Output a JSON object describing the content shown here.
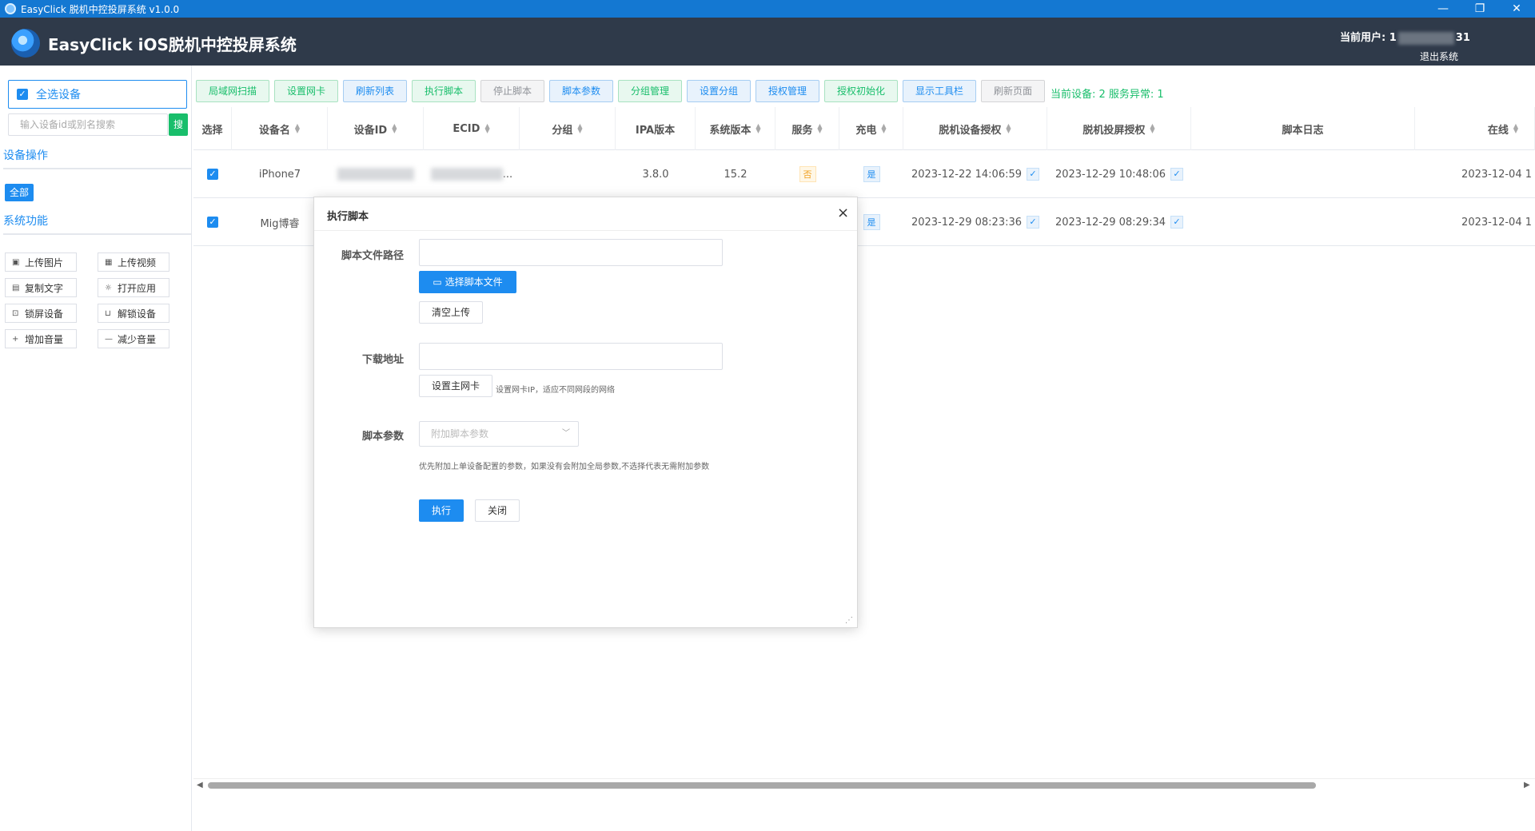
{
  "window": {
    "title": "EasyClick 脱机中控投屏系统 v1.0.0",
    "minimize": "—",
    "restore": "❐",
    "close": "✕"
  },
  "header": {
    "app_title": "EasyClick iOS脱机中控投屏系统",
    "user_label": "当前用户: 1",
    "user_suffix": "31",
    "logout": "退出系统"
  },
  "sidebar": {
    "select_all": "全选设备",
    "search_placeholder": "输入设备id或别名搜索",
    "search_button": "搜",
    "device_ops_title": "设备操作",
    "all_button": "全部",
    "system_title": "系统功能",
    "functions": [
      {
        "label": "上传图片",
        "icon": "image-icon"
      },
      {
        "label": "上传视频",
        "icon": "video-icon"
      },
      {
        "label": "复制文字",
        "icon": "document-icon"
      },
      {
        "label": "打开应用",
        "icon": "sun-icon"
      },
      {
        "label": "锁屏设备",
        "icon": "lock-icon"
      },
      {
        "label": "解锁设备",
        "icon": "unlock-icon"
      },
      {
        "label": "增加音量",
        "icon": "plus-icon"
      },
      {
        "label": "减少音量",
        "icon": "minus-icon"
      }
    ]
  },
  "toolbar": {
    "buttons": [
      {
        "label": "局域网扫描",
        "style": "green"
      },
      {
        "label": "设置网卡",
        "style": "green"
      },
      {
        "label": "刷新列表",
        "style": "blue"
      },
      {
        "label": "执行脚本",
        "style": "green"
      },
      {
        "label": "停止脚本",
        "style": "grey"
      },
      {
        "label": "脚本参数",
        "style": "blue"
      },
      {
        "label": "分组管理",
        "style": "green"
      },
      {
        "label": "设置分组",
        "style": "blue"
      },
      {
        "label": "授权管理",
        "style": "blue"
      },
      {
        "label": "授权初始化",
        "style": "green"
      },
      {
        "label": "显示工具栏",
        "style": "blue"
      },
      {
        "label": "刷新页面",
        "style": "grey"
      }
    ],
    "status": "当前设备: 2 服务异常: 1"
  },
  "table": {
    "columns": [
      "选择",
      "设备名",
      "设备ID",
      "ECID",
      "分组",
      "IPA版本",
      "系统版本",
      "服务",
      "充电",
      "脱机设备授权",
      "脱机投屏授权",
      "脚本日志",
      "在线"
    ],
    "rows": [
      {
        "name": "iPhone7",
        "ecid_suffix": "...",
        "group": "",
        "ipa": "3.8.0",
        "os": "15.2",
        "service": "否",
        "charging": "是",
        "device_auth": "2023-12-22 14:06:59",
        "screen_auth": "2023-12-29 10:48:06",
        "log": "",
        "online": "2023-12-04 1"
      },
      {
        "name": "Mig博睿",
        "ecid_suffix": "",
        "group": "",
        "ipa": "",
        "os": "",
        "service": "",
        "charging": "是",
        "device_auth": "2023-12-29 08:23:36",
        "screen_auth": "2023-12-29 08:29:34",
        "log": "",
        "online": "2023-12-04 1"
      }
    ],
    "check_mark": "✓"
  },
  "modal": {
    "title": "执行脚本",
    "close": "×",
    "script_path_label": "脚本文件路径",
    "select_file_button": "选择脚本文件",
    "clear_upload_button": "清空上传",
    "download_label": "下载地址",
    "set_nic_button": "设置主网卡",
    "set_nic_hint": "设置网卡IP，适应不同网段的网络",
    "params_label": "脚本参数",
    "params_placeholder": "附加脚本参数",
    "params_hint": "优先附加上单设备配置的参数，如果没有会附加全局参数,不选择代表无需附加参数",
    "execute_button": "执行",
    "close_button": "关闭"
  }
}
